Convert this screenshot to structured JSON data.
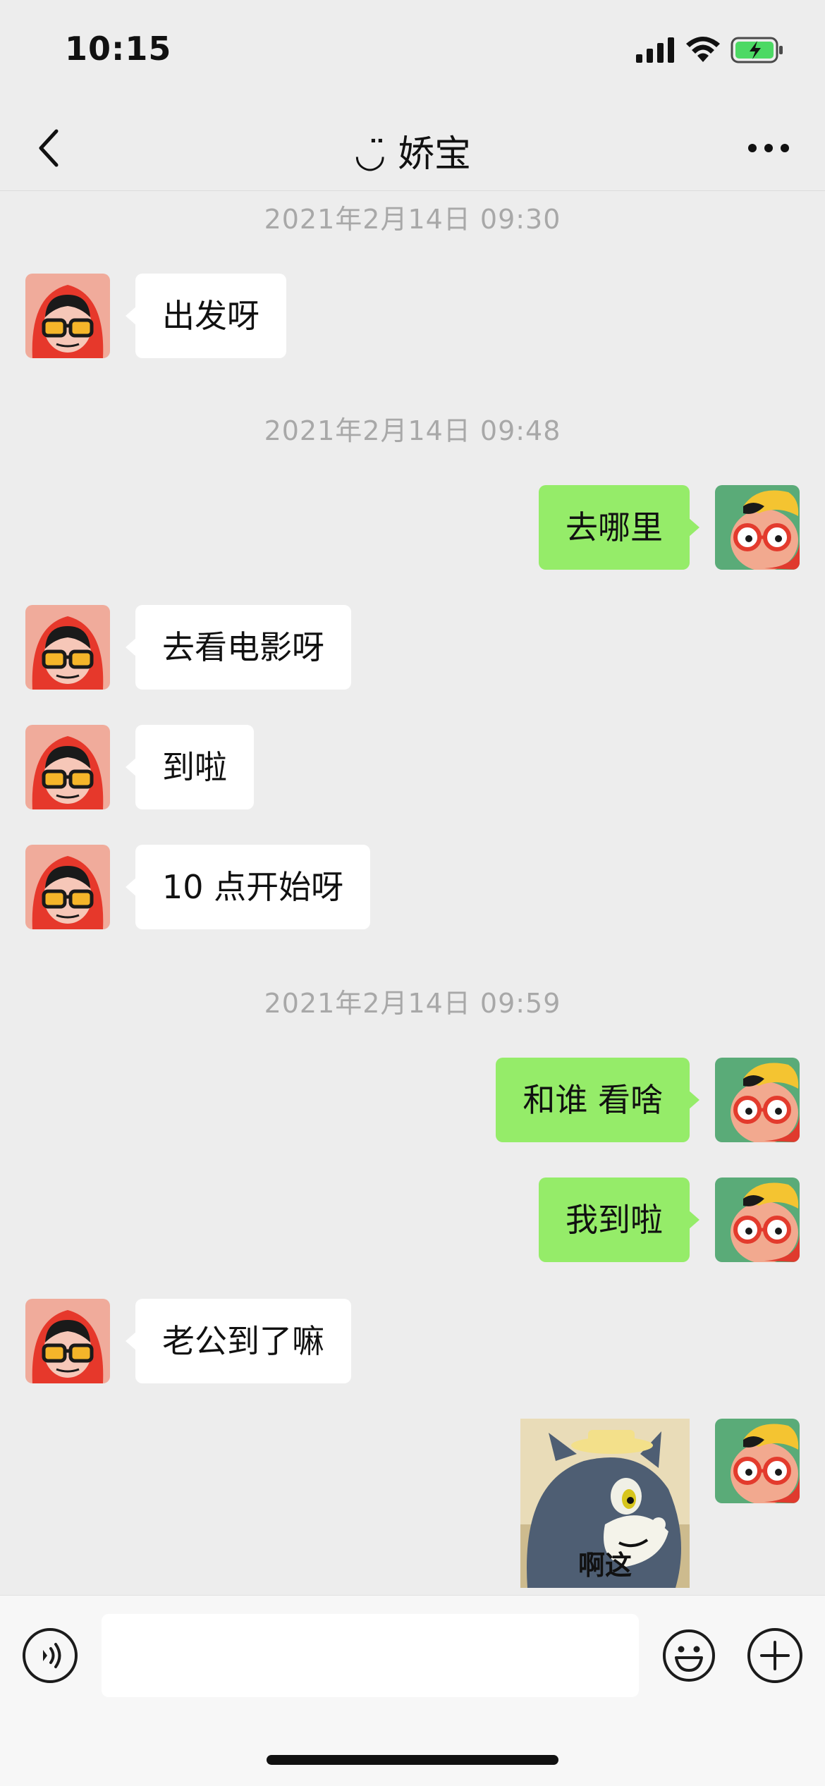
{
  "status_bar": {
    "time": "10:15",
    "icons": [
      "signal-icon",
      "wifi-icon",
      "battery-charging-icon"
    ]
  },
  "nav": {
    "title": "◡̈ 娇宝",
    "back_icon": "chevron-left-icon",
    "more_icon": "ellipsis-icon"
  },
  "messages": [
    {
      "type": "time",
      "text": "2021年2月14日 09:30"
    },
    {
      "type": "msg",
      "side": "left",
      "text": "出发呀"
    },
    {
      "type": "time",
      "text": "2021年2月14日 09:48"
    },
    {
      "type": "msg",
      "side": "right",
      "text": "去哪里"
    },
    {
      "type": "msg",
      "side": "left",
      "text": "去看电影呀"
    },
    {
      "type": "msg",
      "side": "left",
      "text": "到啦"
    },
    {
      "type": "msg",
      "side": "left",
      "text": "10 点开始呀"
    },
    {
      "type": "time",
      "text": "2021年2月14日 09:59"
    },
    {
      "type": "msg",
      "side": "right",
      "text": "和谁 看啥"
    },
    {
      "type": "msg",
      "side": "right",
      "text": "我到啦"
    },
    {
      "type": "msg",
      "side": "left",
      "text": "老公到了嘛"
    },
    {
      "type": "sticker",
      "side": "right",
      "caption": "啊这"
    }
  ],
  "input_bar": {
    "value": "",
    "placeholder": "",
    "voice_icon": "voice-icon",
    "emoji_icon": "emoji-icon",
    "plus_icon": "plus-icon"
  },
  "colors": {
    "background": "#ededed",
    "bubble_self": "#95ec69",
    "bubble_other": "#ffffff",
    "timestamp_text": "#a8a8a8"
  }
}
